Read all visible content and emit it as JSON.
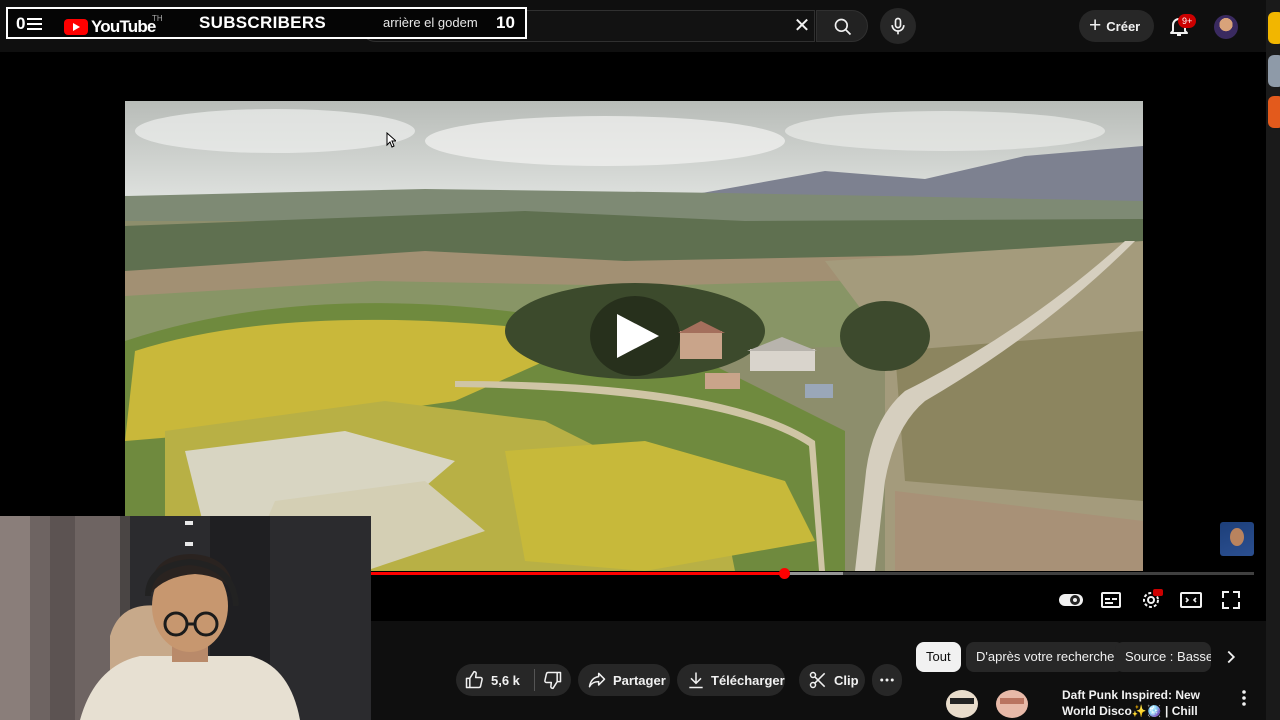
{
  "overlay": {
    "count_left": "0",
    "logo_text": "YouTube",
    "logo_sup": "TH",
    "subscribers_label": "SUBSCRIBERS",
    "count_right": "10"
  },
  "search": {
    "value": "arrière el godem"
  },
  "header": {
    "create_label": "Créer",
    "notif_count": "9+"
  },
  "player": {
    "progress": 0.468,
    "buffered": 0.534
  },
  "actions": {
    "like_count": "5,6 k",
    "share_label": "Partager",
    "download_label": "Télécharger",
    "clip_label": "Clip"
  },
  "chips": [
    "Tout",
    "D'après votre recherche",
    "Source : Basse"
  ],
  "recommendation": {
    "title": "Daft Punk Inspired: New World Disco✨🪩 | Chill Disco, Frenc..."
  },
  "colors": {
    "accent": "#ff0000",
    "background": "#0f0f0f",
    "surface": "#272727"
  },
  "icons": [
    "menu-icon",
    "search-icon",
    "mic-icon",
    "close-icon",
    "bell-icon",
    "like-icon",
    "dislike-icon",
    "share-icon",
    "download-icon",
    "clip-icon",
    "more-icon",
    "autoplay-toggle-icon",
    "subtitles-icon",
    "settings-icon",
    "theater-icon",
    "fullscreen-icon",
    "play-icon"
  ]
}
